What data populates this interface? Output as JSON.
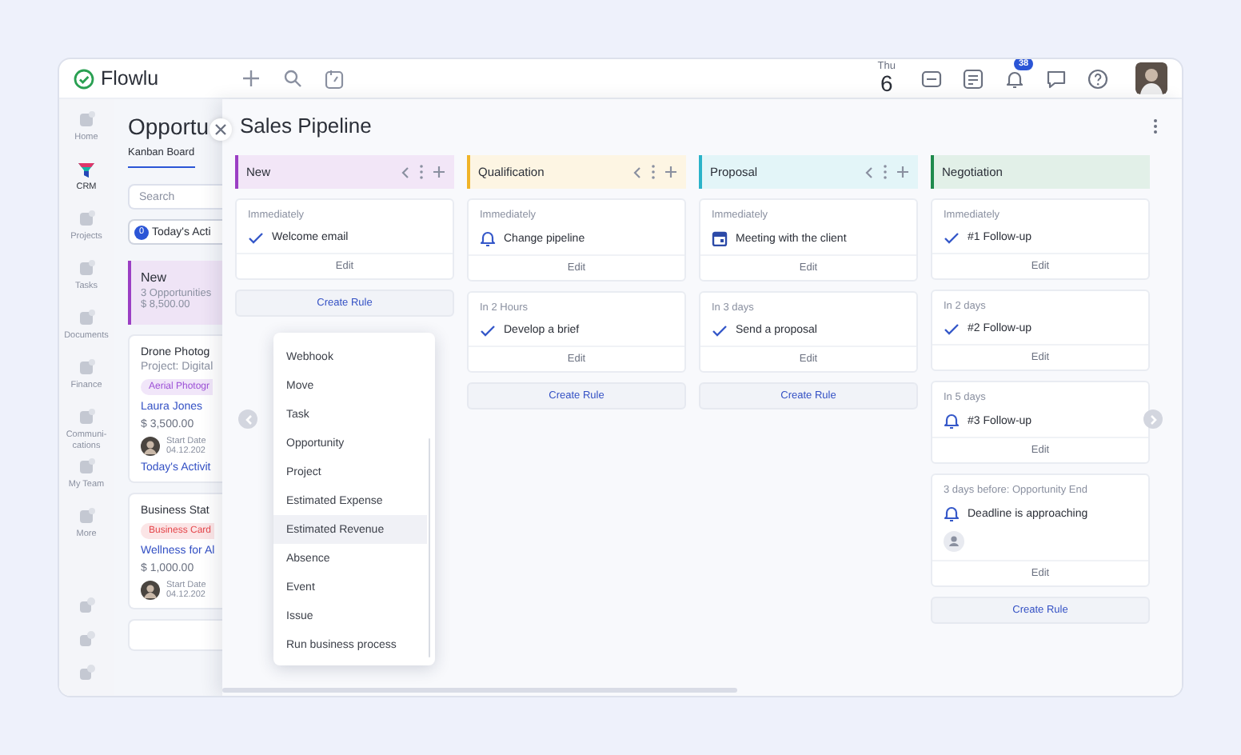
{
  "topbar": {
    "logo": "Flowlu",
    "date": {
      "weekday": "Thu",
      "day": "6"
    },
    "notification_count": "38"
  },
  "sidebar": {
    "items": [
      {
        "label": "Home",
        "selected": false
      },
      {
        "label": "CRM",
        "selected": true
      },
      {
        "label": "Projects",
        "selected": false
      },
      {
        "label": "Tasks",
        "selected": false
      },
      {
        "label": "Documents",
        "selected": false
      },
      {
        "label": "Finance",
        "selected": false
      },
      {
        "label": "Communi-\ncations",
        "selected": false
      },
      {
        "label": "My Team",
        "selected": false
      },
      {
        "label": "More",
        "selected": false
      }
    ]
  },
  "left_panel": {
    "title": "Opportu",
    "tabs": [
      {
        "label": "Kanban Board",
        "selected": true
      }
    ],
    "search": {
      "placeholder": "Search"
    },
    "filter": {
      "count": "0",
      "label": "Today's Acti"
    },
    "stage": {
      "name": "New",
      "count": "3 Opportunities",
      "amount": "$ 8,500.00",
      "color": "#9b3fc4"
    },
    "cards": [
      {
        "title": "Drone Photog",
        "project": "Project: Digital",
        "tag": {
          "label": "Aerial Photogr",
          "color": "#9c4fd6"
        },
        "contact": "Laura Jones",
        "amount": "$ 3,500.00",
        "date_label": "Start Date",
        "date": "04.12.202",
        "activity": "Today's Activit"
      },
      {
        "title": "Business Stat",
        "tag": {
          "label": "Business Card",
          "color": "#e5484d"
        },
        "contact": "Wellness for Al",
        "amount": "$ 1,000.00",
        "date_label": "Start Date",
        "date": "04.12.202"
      }
    ]
  },
  "pipeline": {
    "title": "Sales Pipeline",
    "columns": [
      {
        "name": "New",
        "color": "#9b3fc4",
        "controls": true,
        "rules": [
          {
            "timing": "Immediately",
            "kind": "check",
            "action": "Welcome email",
            "assignee": false,
            "edit": "Edit"
          }
        ],
        "create_rule": "Create Rule"
      },
      {
        "name": "Qualification",
        "color": "#f0b429",
        "controls": true,
        "rules": [
          {
            "timing": "Immediately",
            "kind": "bell",
            "action": "Change pipeline",
            "assignee": false,
            "edit": "Edit"
          },
          {
            "timing": "In 2 Hours",
            "kind": "check",
            "action": "Develop a brief",
            "assignee": false,
            "edit": "Edit"
          }
        ],
        "create_rule": "Create Rule"
      },
      {
        "name": "Proposal",
        "color": "#2bb3c9",
        "controls": true,
        "rules": [
          {
            "timing": "Immediately",
            "kind": "calendar",
            "action": "Meeting with the client",
            "assignee": false,
            "edit": "Edit"
          },
          {
            "timing": "In 3 days",
            "kind": "check",
            "action": "Send a proposal",
            "assignee": false,
            "edit": "Edit"
          }
        ],
        "create_rule": "Create Rule"
      },
      {
        "name": "Negotiation",
        "color": "#1f8a4c",
        "controls": false,
        "rules": [
          {
            "timing": "Immediately",
            "kind": "check",
            "action": "#1 Follow-up",
            "assignee": false,
            "edit": "Edit"
          },
          {
            "timing": "In 2 days",
            "kind": "check",
            "action": "#2 Follow-up",
            "assignee": false,
            "edit": "Edit"
          },
          {
            "timing": "In 5 days",
            "kind": "bell",
            "action": "#3 Follow-up",
            "assignee": false,
            "edit": "Edit"
          },
          {
            "timing": "3 days before: Opportunity End",
            "kind": "bell",
            "action": "Deadline is approaching",
            "assignee": true,
            "edit": "Edit"
          }
        ],
        "create_rule": "Create Rule"
      }
    ],
    "menu": {
      "items": [
        {
          "label": "Webhook",
          "selected": false
        },
        {
          "label": "Move",
          "selected": false
        },
        {
          "label": "Task",
          "selected": false
        },
        {
          "label": "Opportunity",
          "selected": false
        },
        {
          "label": "Project",
          "selected": false
        },
        {
          "label": "Estimated Expense",
          "selected": false
        },
        {
          "label": "Estimated Revenue",
          "selected": true
        },
        {
          "label": "Absence",
          "selected": false
        },
        {
          "label": "Event",
          "selected": false
        },
        {
          "label": "Issue",
          "selected": false
        },
        {
          "label": "Run business process",
          "selected": false
        }
      ]
    }
  }
}
